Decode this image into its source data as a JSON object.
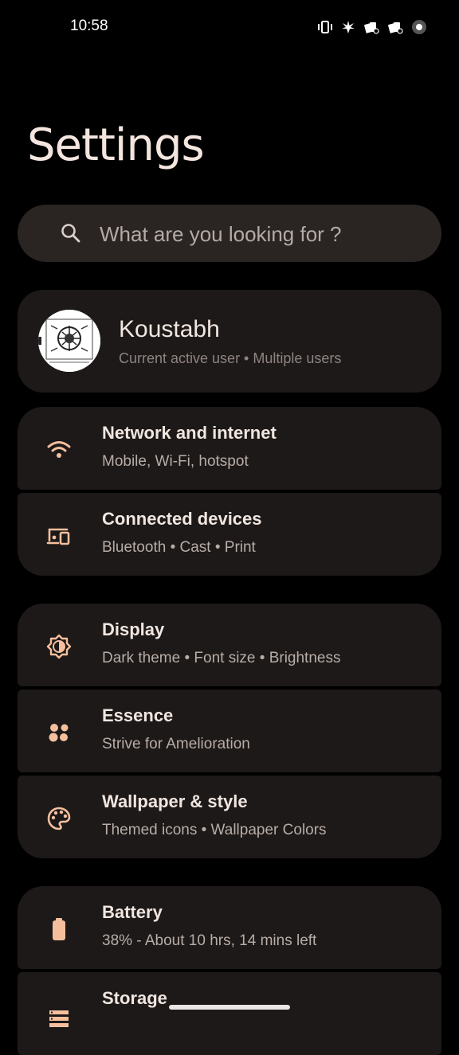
{
  "status_bar": {
    "time": "10:58"
  },
  "page": {
    "title": "Settings"
  },
  "search": {
    "placeholder": "What are you looking for ?"
  },
  "user": {
    "name": "Koustabh",
    "subtitle": "Current active user • Multiple users"
  },
  "groups": [
    {
      "items": [
        {
          "title": "Network and internet",
          "subtitle": "Mobile, Wi-Fi, hotspot",
          "icon": "wifi-icon"
        },
        {
          "title": "Connected devices",
          "subtitle": "Bluetooth • Cast • Print",
          "icon": "devices-icon"
        }
      ]
    },
    {
      "items": [
        {
          "title": "Display",
          "subtitle": "Dark theme • Font size • Brightness",
          "icon": "brightness-icon"
        },
        {
          "title": "Essence",
          "subtitle": "Strive for Amelioration",
          "icon": "dots-cluster-icon"
        },
        {
          "title": "Wallpaper & style",
          "subtitle": "Themed icons • Wallpaper Colors",
          "icon": "palette-icon"
        }
      ]
    },
    {
      "items": [
        {
          "title": "Battery",
          "subtitle": "38% - About 10 hrs, 14 mins left",
          "icon": "battery-icon"
        },
        {
          "title": "Storage",
          "subtitle": "",
          "icon": "storage-icon"
        }
      ]
    }
  ],
  "colors": {
    "background": "#000000",
    "card": "#1c1918",
    "search": "#2a2523",
    "accent": "#f5bf9e",
    "title": "#f1e6e0",
    "subtitle": "#b8aca7"
  }
}
